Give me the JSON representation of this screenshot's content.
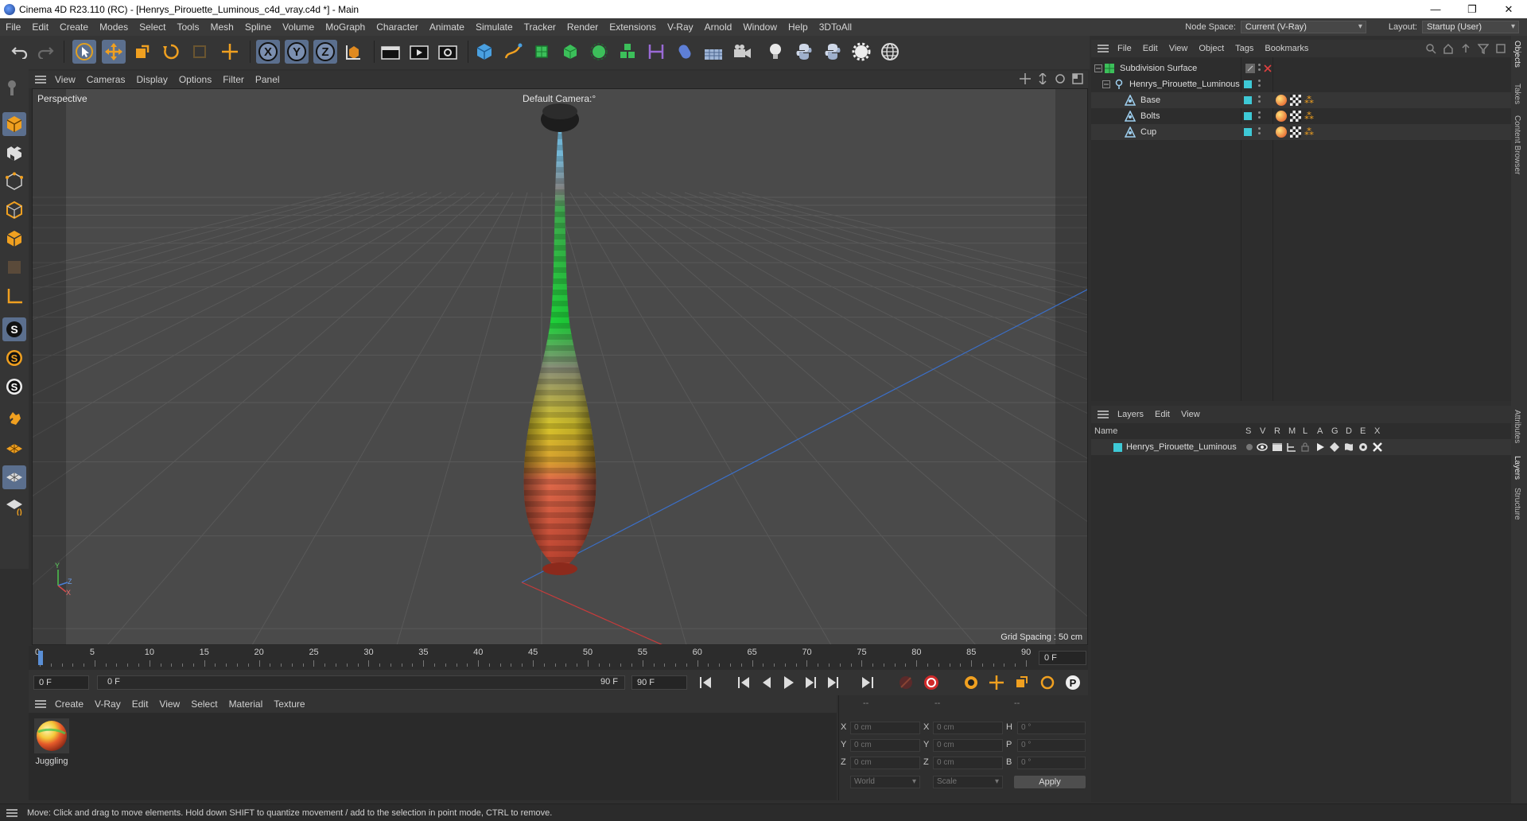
{
  "window": {
    "title": "Cinema 4D R23.110 (RC) - [Henrys_Pirouette_Luminous_c4d_vray.c4d *] - Main",
    "minimize_glyph": "—",
    "restore_glyph": "❐",
    "close_glyph": "✕"
  },
  "menubar": {
    "items": [
      "File",
      "Edit",
      "Create",
      "Modes",
      "Select",
      "Tools",
      "Mesh",
      "Spline",
      "Volume",
      "MoGraph",
      "Character",
      "Animate",
      "Simulate",
      "Tracker",
      "Render",
      "Extensions",
      "V-Ray",
      "Arnold",
      "Window",
      "Help",
      "3DToAll"
    ],
    "node_space_label": "Node Space:",
    "node_space_value": "Current (V-Ray)",
    "layout_label": "Layout:",
    "layout_value": "Startup (User)"
  },
  "toolbar": {
    "axis_x": "X",
    "axis_y": "Y",
    "axis_z": "Z"
  },
  "viewport": {
    "menu": [
      "View",
      "Cameras",
      "Display",
      "Options",
      "Filter",
      "Panel"
    ],
    "label": "Perspective",
    "camera": "Default Camera",
    "camera_suffix": ":°",
    "grid_spacing": "Grid Spacing : 50 cm",
    "axis_y": "Y",
    "axis_z": "Z",
    "axis_x": "X",
    "colors": {
      "bg": "#4a4a4a",
      "grid": "#585858",
      "z_axis": "#3b6fc8",
      "x_axis": "#c83b3b"
    }
  },
  "timeline": {
    "ticks": [
      "0",
      "5",
      "10",
      "15",
      "20",
      "25",
      "30",
      "35",
      "40",
      "45",
      "50",
      "55",
      "60",
      "65",
      "70",
      "75",
      "80",
      "85",
      "90"
    ],
    "current_frame": "0 F",
    "start_field": "0 F",
    "range_start": "0 F",
    "range_end": "90 F",
    "end_field": "90 F"
  },
  "material_manager": {
    "menu": [
      "Create",
      "V-Ray",
      "Edit",
      "View",
      "Select",
      "Material",
      "Texture"
    ],
    "materials": [
      {
        "name": "Juggling"
      }
    ]
  },
  "coordinates": {
    "header_a": "--",
    "header_b": "--",
    "header_c": "--",
    "rows": [
      {
        "lab1": "X",
        "val1": "0 cm",
        "lab2": "X",
        "val2": "0 cm",
        "lab3": "H",
        "val3": "0 °"
      },
      {
        "lab1": "Y",
        "val1": "0 cm",
        "lab2": "Y",
        "val2": "0 cm",
        "lab3": "P",
        "val3": "0 °"
      },
      {
        "lab1": "Z",
        "val1": "0 cm",
        "lab2": "Z",
        "val2": "0 cm",
        "lab3": "B",
        "val3": "0 °"
      }
    ],
    "mode_world": "World",
    "mode_scale": "Scale",
    "apply": "Apply"
  },
  "object_manager": {
    "menu": [
      "File",
      "Edit",
      "View",
      "Object",
      "Tags",
      "Bookmarks"
    ],
    "objects": [
      {
        "name": "Subdivision Surface"
      },
      {
        "name": "Henrys_Pirouette_Luminous"
      },
      {
        "name": "Base"
      },
      {
        "name": "Bolts"
      },
      {
        "name": "Cup"
      }
    ],
    "layer_color": "#3ec9d6"
  },
  "layer_manager": {
    "menu": [
      "Layers",
      "Edit",
      "View"
    ],
    "columns": {
      "name": "Name",
      "s": "S",
      "v": "V",
      "r": "R",
      "m": "M",
      "l": "L",
      "a": "A",
      "g": "G",
      "d": "D",
      "e": "E",
      "x": "X"
    },
    "layers": [
      {
        "name": "Henrys_Pirouette_Luminous"
      }
    ]
  },
  "right_tabs": [
    "Objects",
    "Takes",
    "Content Browser",
    "Attributes",
    "Layers",
    "Structure"
  ],
  "status": {
    "message": "Move: Click and drag to move elements. Hold down SHIFT to quantize movement / add to the selection in point mode, CTRL to remove."
  }
}
